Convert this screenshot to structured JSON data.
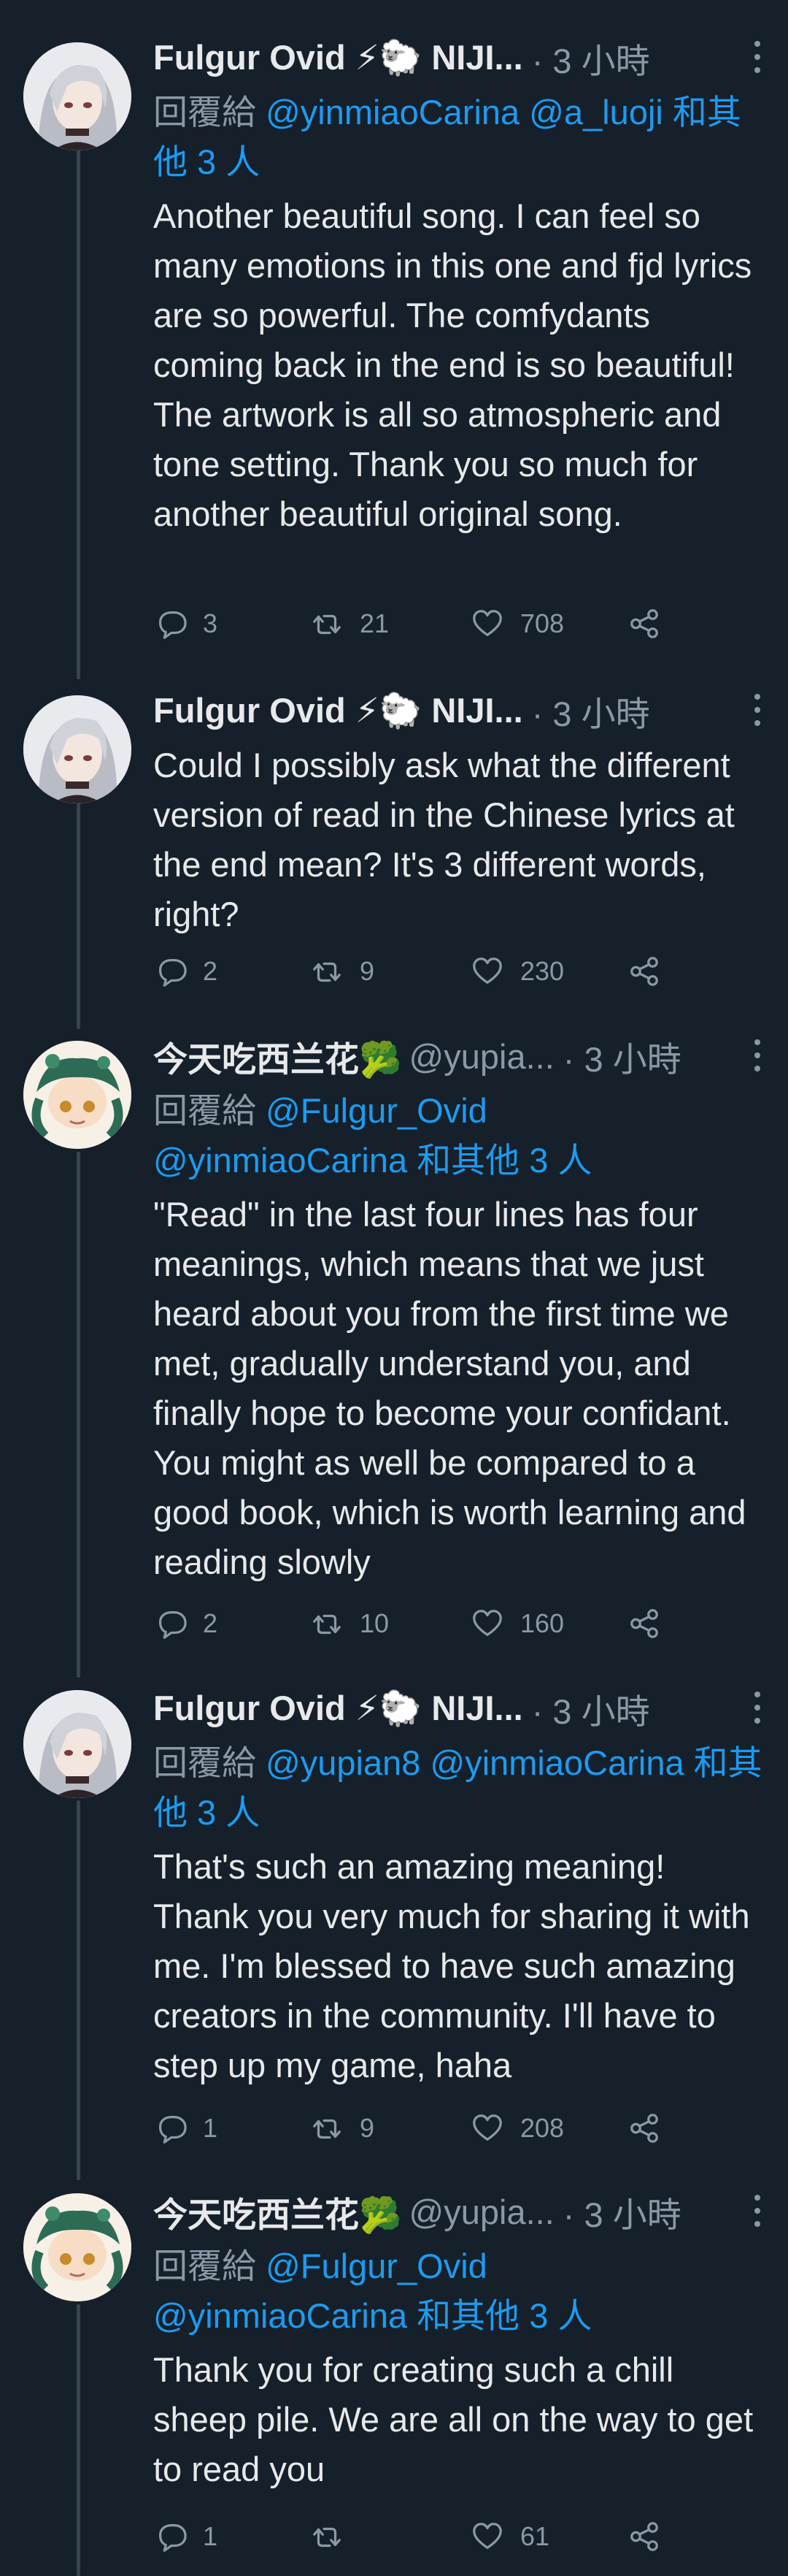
{
  "tweets": [
    {
      "name": "Fulgur Ovid ⚡🐑 NIJI...",
      "handle": "",
      "time": "· 3 小時",
      "reply_prefix": "回覆給",
      "reply_links": [
        "@yinmiaoCarina",
        "@a_luoji"
      ],
      "reply_suffix": "和其他 3 人",
      "text": "Another beautiful song. I can feel so many emotions in this one and fjd lyrics are so powerful. The comfydants coming back in the end is so beautiful! The artwork is all so atmospheric and tone setting. Thank you so much for another beautiful original song.",
      "replies": "3",
      "retweets": "21",
      "likes": "708"
    },
    {
      "name": "Fulgur Ovid ⚡🐑 NIJI...",
      "handle": "",
      "time": "· 3 小時",
      "text": "Could I possibly ask what the different version of read in the Chinese lyrics at the end mean? It's 3 different words, right?",
      "replies": "2",
      "retweets": "9",
      "likes": "230"
    },
    {
      "name": "今天吃西兰花🥦",
      "handle": "@yupia...",
      "time": "· 3 小時",
      "reply_prefix": "回覆給",
      "reply_links": [
        "@Fulgur_Ovid",
        "@yinmiaoCarina"
      ],
      "reply_suffix": "和其他 3 人",
      "text": "\"Read\" in the last four lines has four meanings, which means that we just heard about you from the first time we met, gradually understand you, and finally hope to become your confidant. You might as well be compared to a good book, which is worth learning and reading slowly",
      "replies": "2",
      "retweets": "10",
      "likes": "160"
    },
    {
      "name": "Fulgur Ovid ⚡🐑 NIJI...",
      "handle": "",
      "time": "· 3 小時",
      "reply_prefix": "回覆給",
      "reply_links": [
        "@yupian8",
        "@yinmiaoCarina"
      ],
      "reply_suffix": "和其他 3 人",
      "text": "That's such an amazing meaning! Thank you very much for sharing it with me. I'm blessed to have such amazing creators in the community. I'll have to step up my game, haha",
      "replies": "1",
      "retweets": "9",
      "likes": "208"
    },
    {
      "name": "今天吃西兰花🥦",
      "handle": "@yupia...",
      "time": "· 3 小時",
      "reply_prefix": "回覆給",
      "reply_links": [
        "@Fulgur_Ovid",
        "@yinmiaoCarina"
      ],
      "reply_suffix": "和其他 3 人",
      "text": "Thank you for creating such a chill sheep pile. We are all on the way to get to read you",
      "replies": "1",
      "retweets": "",
      "likes": "61"
    }
  ]
}
